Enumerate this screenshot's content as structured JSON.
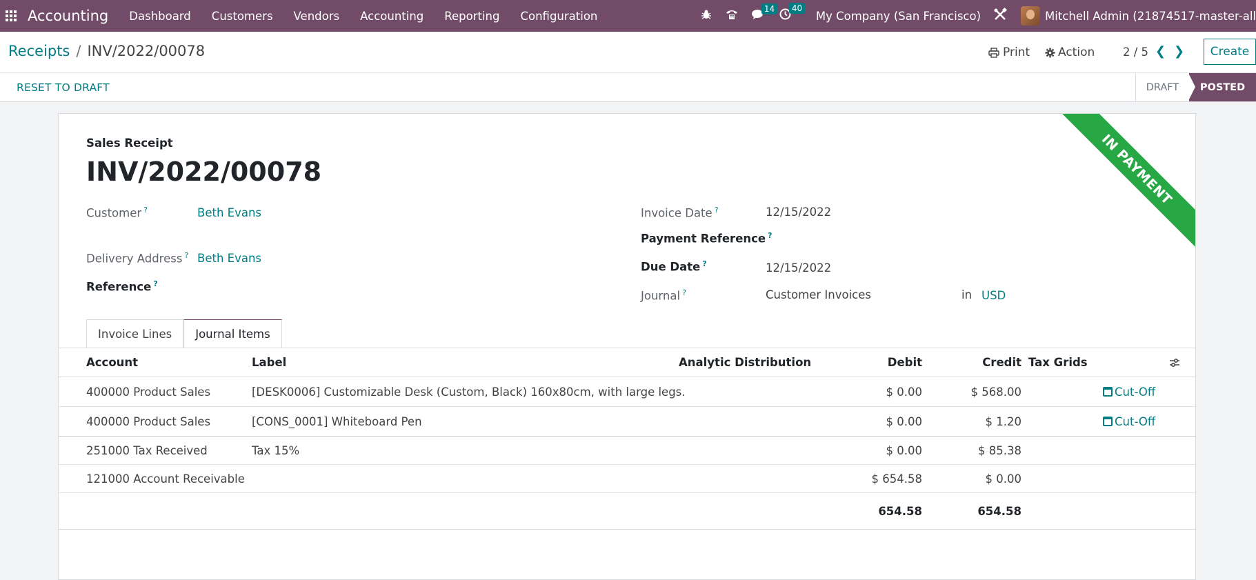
{
  "navbar": {
    "brand": "Accounting",
    "menu": [
      "Dashboard",
      "Customers",
      "Vendors",
      "Accounting",
      "Reporting",
      "Configuration"
    ],
    "messages_count": "14",
    "activities_count": "40",
    "company": "My Company (San Francisco)",
    "user": "Mitchell Admin (21874517-master-all"
  },
  "control": {
    "breadcrumb_parent": "Receipts",
    "breadcrumb_separator": "/",
    "breadcrumb_current": "INV/2022/00078",
    "print_label": "Print",
    "action_label": "Action",
    "pager": "2 / 5",
    "create_label": "Create"
  },
  "status": {
    "reset_label": "RESET TO DRAFT",
    "stages": [
      "DRAFT",
      "POSTED"
    ],
    "active_stage": "POSTED"
  },
  "form": {
    "ribbon": "IN PAYMENT",
    "doc_type": "Sales Receipt",
    "doc_name": "INV/2022/00078",
    "customer_label": "Customer",
    "customer": "Beth Evans",
    "delivery_label": "Delivery Address",
    "delivery": "Beth Evans",
    "reference_label": "Reference",
    "invoice_date_label": "Invoice Date",
    "invoice_date": "12/15/2022",
    "payment_ref_label": "Payment Reference",
    "due_date_label": "Due Date",
    "due_date": "12/15/2022",
    "journal_label": "Journal",
    "journal": "Customer Invoices",
    "in_label": "in",
    "currency": "USD",
    "help_mark": "?"
  },
  "tabs": [
    "Invoice Lines",
    "Journal Items"
  ],
  "active_tab": "Journal Items",
  "table": {
    "headers": {
      "account": "Account",
      "label": "Label",
      "analytic": "Analytic Distribution",
      "debit": "Debit",
      "credit": "Credit",
      "tax_grids": "Tax Grids"
    },
    "rows": [
      {
        "account": "400000 Product Sales",
        "label": "[DESK0006] Customizable Desk (Custom, Black) 160x80cm, with large legs.",
        "debit": "$ 0.00",
        "credit": "$ 568.00",
        "cutoff": "Cut-Off"
      },
      {
        "account": "400000 Product Sales",
        "label": "[CONS_0001] Whiteboard Pen",
        "debit": "$ 0.00",
        "credit": "$ 1.20",
        "cutoff": "Cut-Off"
      },
      {
        "account": "251000 Tax Received",
        "label": "Tax 15%",
        "debit": "$ 0.00",
        "credit": "$ 85.38",
        "cutoff": ""
      },
      {
        "account": "121000 Account Receivable",
        "label": "",
        "debit": "$ 654.58",
        "credit": "$ 0.00",
        "cutoff": ""
      }
    ],
    "total_debit": "654.58",
    "total_credit": "654.58"
  },
  "colors": {
    "brand": "#714b67",
    "link": "#017e84",
    "ribbon": "#28a745"
  }
}
